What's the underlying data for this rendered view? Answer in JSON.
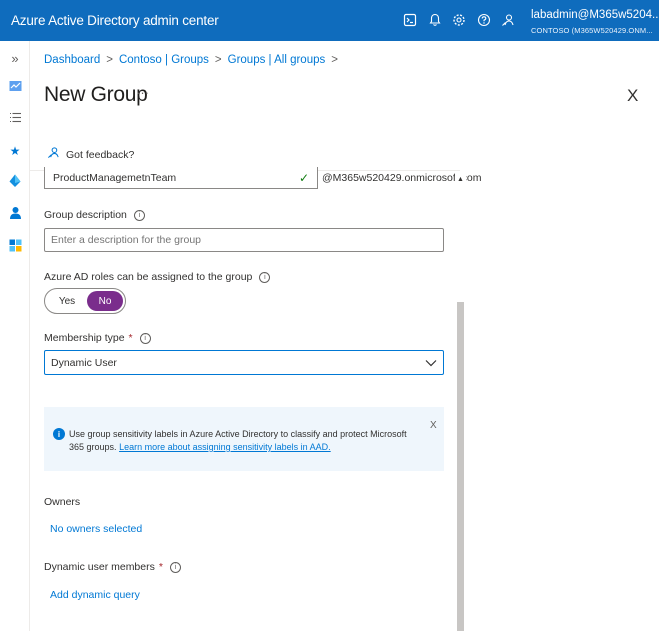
{
  "topbar": {
    "app_title": "Azure Active Directory admin center",
    "user_name": "labadmin@M365w5204...",
    "user_tenant": "CONTOSO (M365W520429.ONM..."
  },
  "rail": {
    "collapse_glyph": "»",
    "items": [
      "dashboard-icon",
      "list-icon",
      "favorites-star-icon",
      "azure-ad-icon",
      "users-icon",
      "enterprise-apps-icon"
    ]
  },
  "breadcrumb": {
    "items": [
      "Dashboard",
      "Contoso | Groups",
      "Groups | All groups"
    ],
    "separator": ">"
  },
  "page": {
    "title": "New Group",
    "more_glyph": "···",
    "close_glyph": "X",
    "feedback_label": "Got feedback?"
  },
  "form": {
    "group_name_value": "ProductManagemetnTeam",
    "domain_suffix": "@M365w520429.onmicrosoft.com",
    "description_label": "Group description",
    "description_placeholder": "Enter a description for the group",
    "roles_label": "Azure AD roles can be assigned to the group",
    "toggle_yes": "Yes",
    "toggle_no": "No",
    "toggle_selected": "No",
    "membership_label": "Membership type",
    "required_mark": "*",
    "membership_value": "Dynamic User",
    "info_message": "Use group sensitivity labels in Azure Active Directory to classify and protect Microsoft 365 groups.",
    "info_link": "Learn more about assigning sensitivity labels in AAD.",
    "info_close": "X",
    "owners_label": "Owners",
    "owners_link": "No owners selected",
    "dynamic_members_label": "Dynamic user members",
    "dynamic_query_link": "Add dynamic query"
  },
  "colors": {
    "topbar": "#0f6cbd",
    "link": "#0078d4",
    "toggle_on": "#7a2d8c",
    "info_bg": "#eff6fc",
    "required": "#a4262c"
  }
}
